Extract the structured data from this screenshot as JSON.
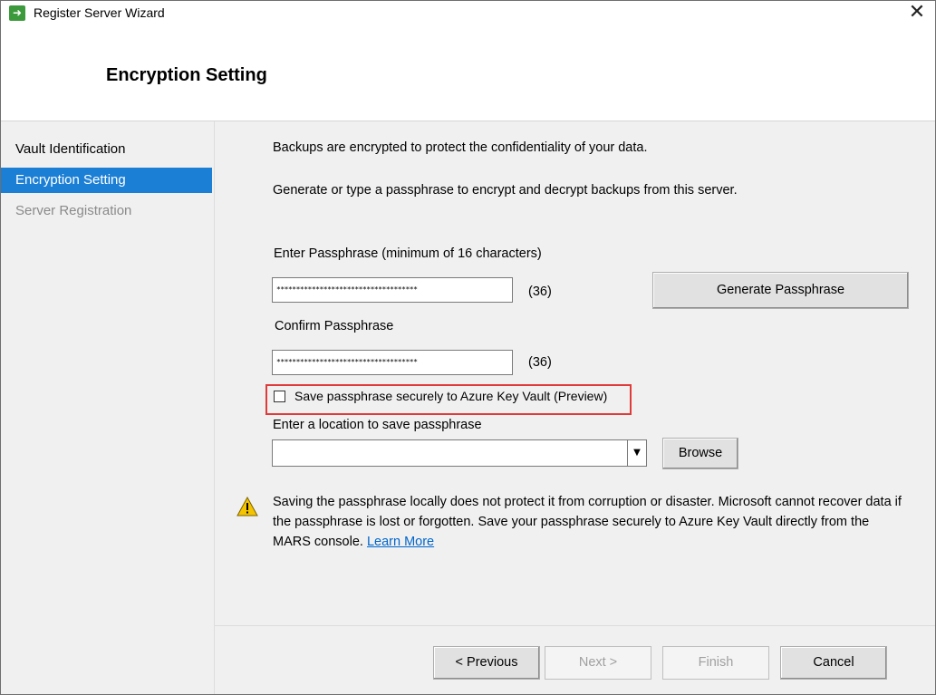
{
  "window": {
    "title": "Register Server Wizard",
    "close_glyph": "✕"
  },
  "header": {
    "title": "Encryption Setting"
  },
  "sidebar": {
    "items": [
      {
        "label": "Vault Identification",
        "state": "normal"
      },
      {
        "label": "Encryption Setting",
        "state": "active"
      },
      {
        "label": "Server Registration",
        "state": "disabled"
      }
    ]
  },
  "main": {
    "intro_line1": "Backups are encrypted to protect the confidentiality of your data.",
    "intro_line2": "Generate or type a passphrase to encrypt and decrypt backups from this server.",
    "passphrase_label": "Enter Passphrase (minimum of 16 characters)",
    "passphrase_value": "************************************",
    "passphrase_count": "(36)",
    "generate_button": "Generate Passphrase",
    "confirm_label": "Confirm Passphrase",
    "confirm_value": "************************************",
    "confirm_count": "(36)",
    "keyvault_checkbox_label": "Save passphrase securely to Azure Key Vault (Preview)",
    "keyvault_checked": false,
    "location_label": "Enter a location to save passphrase",
    "location_value": "",
    "browse_button": "Browse",
    "warning_text": "Saving the passphrase locally does not protect it from corruption or disaster. Microsoft cannot recover data if the passphrase is lost or forgotten. Save your passphrase securely to Azure Key Vault directly from the MARS console.",
    "learn_more": "Learn More"
  },
  "footer": {
    "previous_button": "< Previous",
    "next_button": "Next >",
    "finish_button": "Finish",
    "cancel_button": "Cancel"
  },
  "colors": {
    "accent": "#1c7fd6",
    "highlight_border": "#e03a3a",
    "link": "#0066cc",
    "warning_icon": "#f5c400"
  },
  "icons": {
    "app": "arrow-right-icon",
    "close": "close-icon",
    "warning": "warning-triangle-icon",
    "dropdown": "chevron-down-icon"
  }
}
